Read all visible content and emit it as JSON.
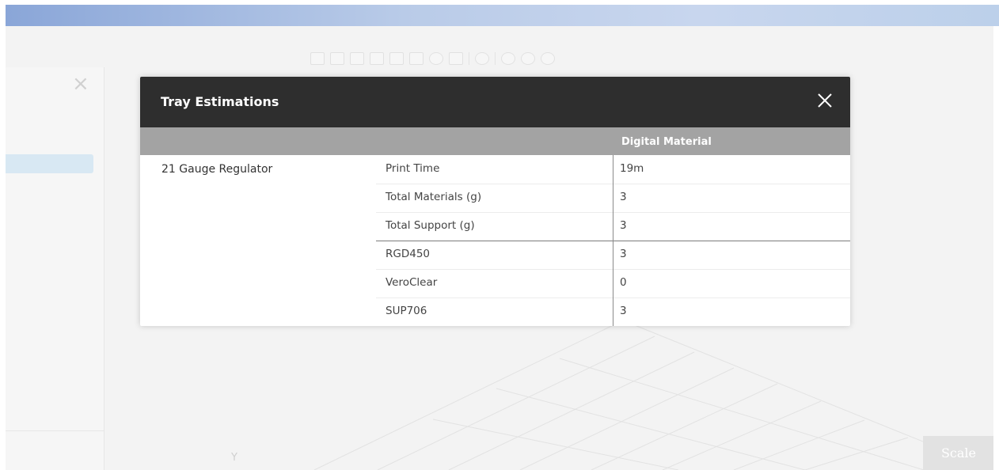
{
  "window": {
    "titlebar_color": "#8aa6d8"
  },
  "toolbar": {
    "icons": [
      "view-front-icon",
      "view-back-icon",
      "view-left-icon",
      "view-right-icon",
      "view-top-icon",
      "view-bottom-icon",
      "view-iso-icon",
      "view-custom-icon",
      "zoom-fit-icon",
      "select-one-icon",
      "select-all-icon",
      "select-group-icon"
    ]
  },
  "viewport": {
    "axis_label": "Y",
    "scale_button": "Scale"
  },
  "modal": {
    "title": "Tray Estimations",
    "column_header": "Digital Material",
    "model_name": "21 Gauge Regulator",
    "rows": [
      {
        "metric": "Print Time",
        "value": "19m"
      },
      {
        "metric": "Total Materials (g)",
        "value": "3"
      },
      {
        "metric": "Total Support (g)",
        "value": "3"
      },
      {
        "metric": "RGD450",
        "value": "3"
      },
      {
        "metric": "VeroClear",
        "value": "0"
      },
      {
        "metric": "SUP706",
        "value": "3"
      }
    ]
  },
  "colors": {
    "header_dark": "#2e2e2e",
    "column_header_gray": "#a3a3a3",
    "selected_item": "#d8e8f3"
  }
}
